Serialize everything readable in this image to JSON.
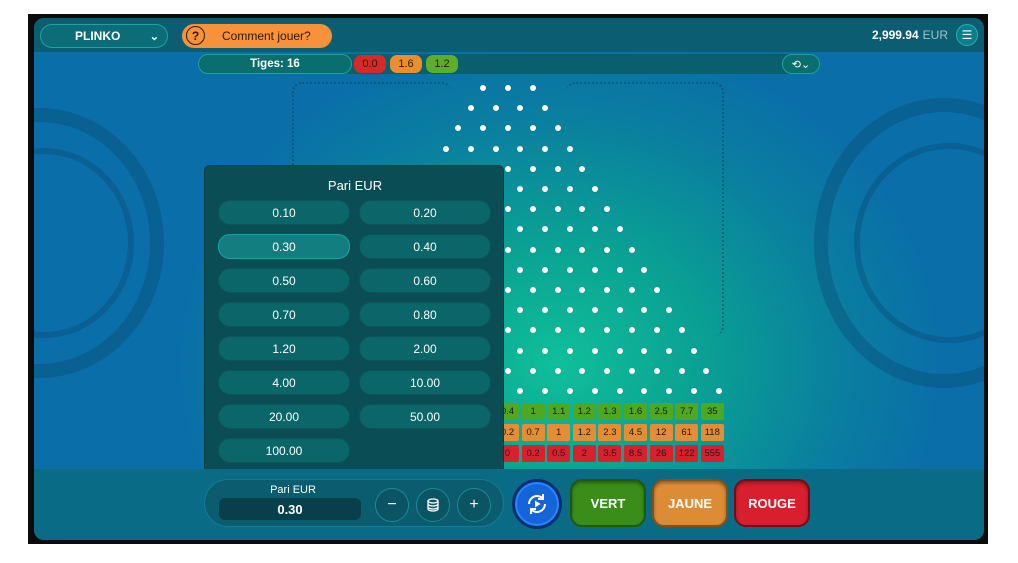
{
  "header": {
    "game_select": "PLINKO",
    "how_to_play": "Comment jouer?",
    "balance_amount": "2,999.94",
    "balance_currency": "EUR"
  },
  "info": {
    "pins_label": "Tiges: 16",
    "history": [
      {
        "value": "0.0",
        "color": "#d62a2a"
      },
      {
        "value": "1.6",
        "color": "#ea8e2e"
      },
      {
        "value": "1.2",
        "color": "#5fae2a"
      }
    ]
  },
  "bet_panel": {
    "title": "Pari EUR",
    "options": [
      "0.10",
      "0.20",
      "0.30",
      "0.40",
      "0.50",
      "0.60",
      "0.70",
      "0.80",
      "1.20",
      "2.00",
      "4.00",
      "10.00",
      "20.00",
      "50.00",
      "100.00"
    ],
    "selected": "0.30"
  },
  "multipliers": {
    "green": [
      "0.4",
      "1",
      "1.1",
      "1.2",
      "1.3",
      "1.6",
      "2.5",
      "7.7",
      "35"
    ],
    "yellow": [
      "0.2",
      "0.7",
      "1",
      "1.2",
      "2.3",
      "4.5",
      "12",
      "61",
      "118"
    ],
    "red": [
      "0",
      "0.2",
      "0.5",
      "2",
      "3.5",
      "8.5",
      "26",
      "122",
      "555"
    ]
  },
  "bottom": {
    "bet_label": "Pari EUR",
    "bet_value": "0.30",
    "minus": "−",
    "plus": "+",
    "green_button": "VERT",
    "yellow_button": "JAUNE",
    "red_button": "ROUGE"
  },
  "colors": {
    "green": "#3b8d19",
    "yellow": "#dd8c35",
    "red": "#d81f2e",
    "auto": "#1565d8"
  }
}
